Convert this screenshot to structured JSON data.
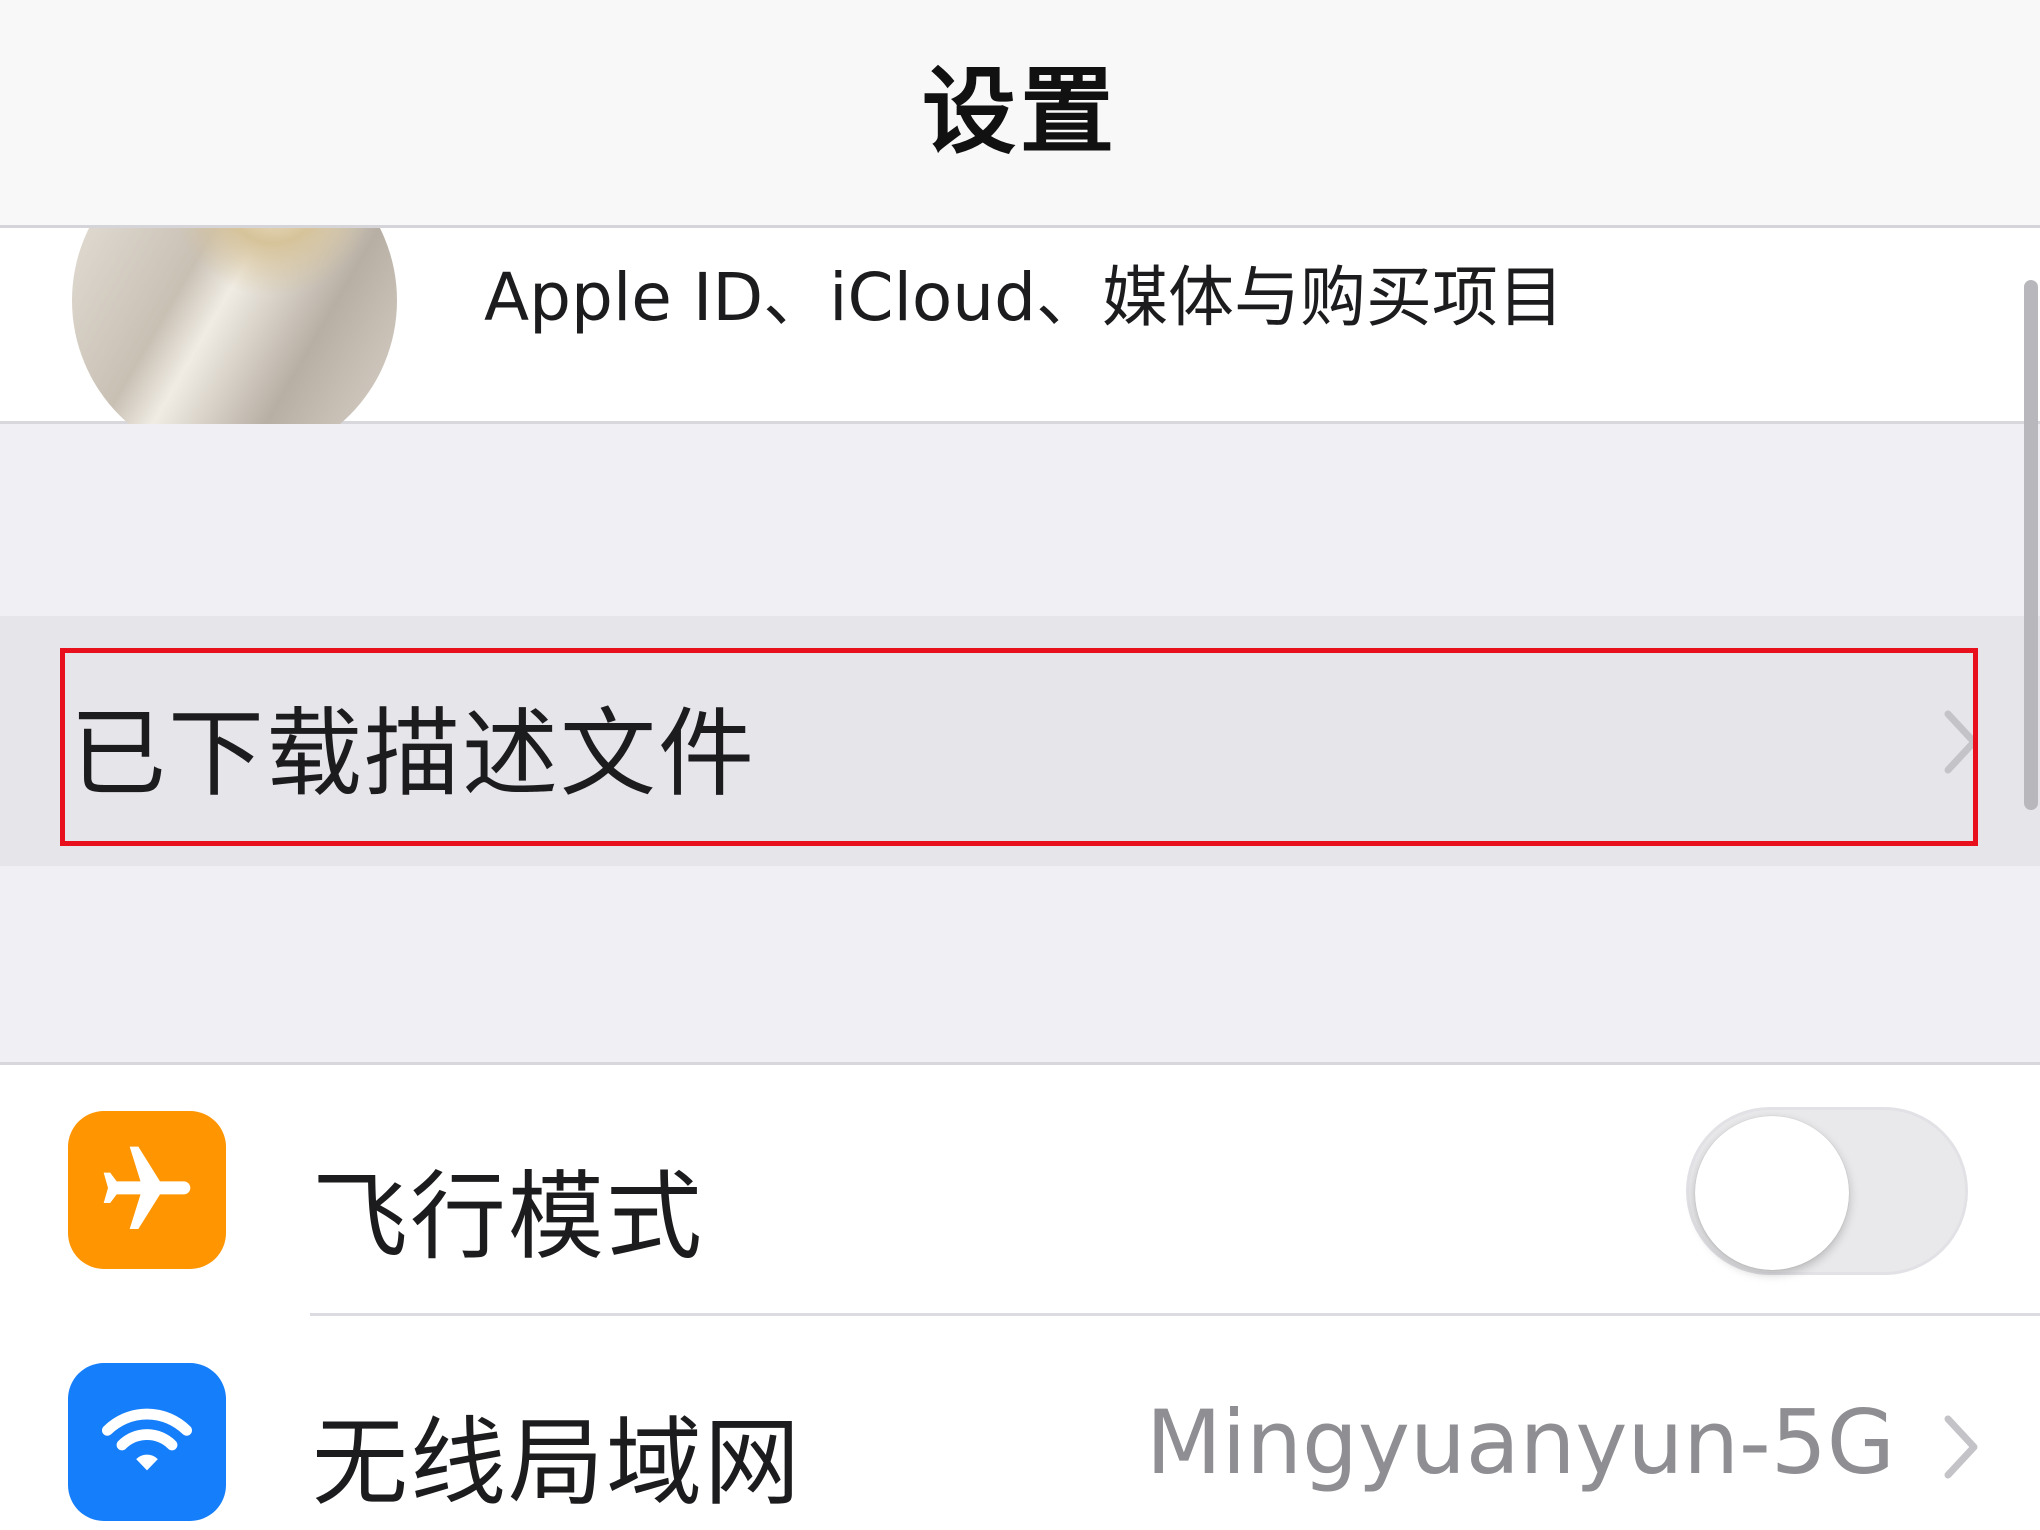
{
  "nav": {
    "title": "设置"
  },
  "profile": {
    "subtitle": "Apple ID、iCloud、媒体与购买项目"
  },
  "downloaded_profile": {
    "label": "已下载描述文件"
  },
  "settings": {
    "airplane": {
      "label": "飞行模式",
      "icon": "airplane-icon",
      "icon_color": "#ff9500",
      "enabled": false
    },
    "wifi": {
      "label": "无线局域网",
      "value": "Mingyuanyun-5G",
      "icon": "wifi-icon",
      "icon_color": "#147efb"
    }
  },
  "colors": {
    "highlight": "#e8101c",
    "background": "#efeff4"
  }
}
